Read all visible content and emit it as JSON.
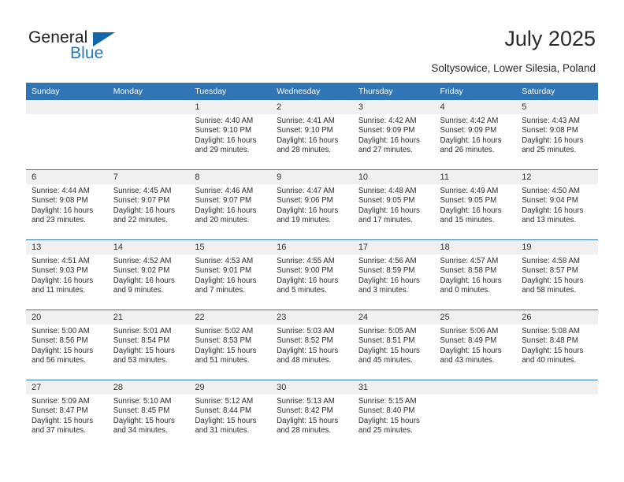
{
  "brand": {
    "name_part1": "General",
    "name_part2": "Blue",
    "triangle_color": "#1266ab",
    "blue_color": "#1f7ac4"
  },
  "header": {
    "title": "July 2025",
    "subtitle": "Soltysowice, Lower Silesia, Poland",
    "accent_color": "#3075b5"
  },
  "calendar": {
    "weekdays": [
      "Sunday",
      "Monday",
      "Tuesday",
      "Wednesday",
      "Thursday",
      "Friday",
      "Saturday"
    ],
    "labels": {
      "sunrise": "Sunrise:",
      "sunset": "Sunset:",
      "daylight": "Daylight:"
    },
    "weeks": [
      [
        {
          "day": "",
          "empty": true
        },
        {
          "day": "",
          "empty": true
        },
        {
          "day": "1",
          "sunrise": "Sunrise: 4:40 AM",
          "sunset": "Sunset: 9:10 PM",
          "daylight_l1": "Daylight: 16 hours",
          "daylight_l2": "and 29 minutes."
        },
        {
          "day": "2",
          "sunrise": "Sunrise: 4:41 AM",
          "sunset": "Sunset: 9:10 PM",
          "daylight_l1": "Daylight: 16 hours",
          "daylight_l2": "and 28 minutes."
        },
        {
          "day": "3",
          "sunrise": "Sunrise: 4:42 AM",
          "sunset": "Sunset: 9:09 PM",
          "daylight_l1": "Daylight: 16 hours",
          "daylight_l2": "and 27 minutes."
        },
        {
          "day": "4",
          "sunrise": "Sunrise: 4:42 AM",
          "sunset": "Sunset: 9:09 PM",
          "daylight_l1": "Daylight: 16 hours",
          "daylight_l2": "and 26 minutes."
        },
        {
          "day": "5",
          "sunrise": "Sunrise: 4:43 AM",
          "sunset": "Sunset: 9:08 PM",
          "daylight_l1": "Daylight: 16 hours",
          "daylight_l2": "and 25 minutes."
        }
      ],
      [
        {
          "day": "6",
          "sunrise": "Sunrise: 4:44 AM",
          "sunset": "Sunset: 9:08 PM",
          "daylight_l1": "Daylight: 16 hours",
          "daylight_l2": "and 23 minutes."
        },
        {
          "day": "7",
          "sunrise": "Sunrise: 4:45 AM",
          "sunset": "Sunset: 9:07 PM",
          "daylight_l1": "Daylight: 16 hours",
          "daylight_l2": "and 22 minutes."
        },
        {
          "day": "8",
          "sunrise": "Sunrise: 4:46 AM",
          "sunset": "Sunset: 9:07 PM",
          "daylight_l1": "Daylight: 16 hours",
          "daylight_l2": "and 20 minutes."
        },
        {
          "day": "9",
          "sunrise": "Sunrise: 4:47 AM",
          "sunset": "Sunset: 9:06 PM",
          "daylight_l1": "Daylight: 16 hours",
          "daylight_l2": "and 19 minutes."
        },
        {
          "day": "10",
          "sunrise": "Sunrise: 4:48 AM",
          "sunset": "Sunset: 9:05 PM",
          "daylight_l1": "Daylight: 16 hours",
          "daylight_l2": "and 17 minutes."
        },
        {
          "day": "11",
          "sunrise": "Sunrise: 4:49 AM",
          "sunset": "Sunset: 9:05 PM",
          "daylight_l1": "Daylight: 16 hours",
          "daylight_l2": "and 15 minutes."
        },
        {
          "day": "12",
          "sunrise": "Sunrise: 4:50 AM",
          "sunset": "Sunset: 9:04 PM",
          "daylight_l1": "Daylight: 16 hours",
          "daylight_l2": "and 13 minutes."
        }
      ],
      [
        {
          "day": "13",
          "sunrise": "Sunrise: 4:51 AM",
          "sunset": "Sunset: 9:03 PM",
          "daylight_l1": "Daylight: 16 hours",
          "daylight_l2": "and 11 minutes."
        },
        {
          "day": "14",
          "sunrise": "Sunrise: 4:52 AM",
          "sunset": "Sunset: 9:02 PM",
          "daylight_l1": "Daylight: 16 hours",
          "daylight_l2": "and 9 minutes."
        },
        {
          "day": "15",
          "sunrise": "Sunrise: 4:53 AM",
          "sunset": "Sunset: 9:01 PM",
          "daylight_l1": "Daylight: 16 hours",
          "daylight_l2": "and 7 minutes."
        },
        {
          "day": "16",
          "sunrise": "Sunrise: 4:55 AM",
          "sunset": "Sunset: 9:00 PM",
          "daylight_l1": "Daylight: 16 hours",
          "daylight_l2": "and 5 minutes."
        },
        {
          "day": "17",
          "sunrise": "Sunrise: 4:56 AM",
          "sunset": "Sunset: 8:59 PM",
          "daylight_l1": "Daylight: 16 hours",
          "daylight_l2": "and 3 minutes."
        },
        {
          "day": "18",
          "sunrise": "Sunrise: 4:57 AM",
          "sunset": "Sunset: 8:58 PM",
          "daylight_l1": "Daylight: 16 hours",
          "daylight_l2": "and 0 minutes."
        },
        {
          "day": "19",
          "sunrise": "Sunrise: 4:58 AM",
          "sunset": "Sunset: 8:57 PM",
          "daylight_l1": "Daylight: 15 hours",
          "daylight_l2": "and 58 minutes."
        }
      ],
      [
        {
          "day": "20",
          "sunrise": "Sunrise: 5:00 AM",
          "sunset": "Sunset: 8:56 PM",
          "daylight_l1": "Daylight: 15 hours",
          "daylight_l2": "and 56 minutes."
        },
        {
          "day": "21",
          "sunrise": "Sunrise: 5:01 AM",
          "sunset": "Sunset: 8:54 PM",
          "daylight_l1": "Daylight: 15 hours",
          "daylight_l2": "and 53 minutes."
        },
        {
          "day": "22",
          "sunrise": "Sunrise: 5:02 AM",
          "sunset": "Sunset: 8:53 PM",
          "daylight_l1": "Daylight: 15 hours",
          "daylight_l2": "and 51 minutes."
        },
        {
          "day": "23",
          "sunrise": "Sunrise: 5:03 AM",
          "sunset": "Sunset: 8:52 PM",
          "daylight_l1": "Daylight: 15 hours",
          "daylight_l2": "and 48 minutes."
        },
        {
          "day": "24",
          "sunrise": "Sunrise: 5:05 AM",
          "sunset": "Sunset: 8:51 PM",
          "daylight_l1": "Daylight: 15 hours",
          "daylight_l2": "and 45 minutes."
        },
        {
          "day": "25",
          "sunrise": "Sunrise: 5:06 AM",
          "sunset": "Sunset: 8:49 PM",
          "daylight_l1": "Daylight: 15 hours",
          "daylight_l2": "and 43 minutes."
        },
        {
          "day": "26",
          "sunrise": "Sunrise: 5:08 AM",
          "sunset": "Sunset: 8:48 PM",
          "daylight_l1": "Daylight: 15 hours",
          "daylight_l2": "and 40 minutes."
        }
      ],
      [
        {
          "day": "27",
          "sunrise": "Sunrise: 5:09 AM",
          "sunset": "Sunset: 8:47 PM",
          "daylight_l1": "Daylight: 15 hours",
          "daylight_l2": "and 37 minutes."
        },
        {
          "day": "28",
          "sunrise": "Sunrise: 5:10 AM",
          "sunset": "Sunset: 8:45 PM",
          "daylight_l1": "Daylight: 15 hours",
          "daylight_l2": "and 34 minutes."
        },
        {
          "day": "29",
          "sunrise": "Sunrise: 5:12 AM",
          "sunset": "Sunset: 8:44 PM",
          "daylight_l1": "Daylight: 15 hours",
          "daylight_l2": "and 31 minutes."
        },
        {
          "day": "30",
          "sunrise": "Sunrise: 5:13 AM",
          "sunset": "Sunset: 8:42 PM",
          "daylight_l1": "Daylight: 15 hours",
          "daylight_l2": "and 28 minutes."
        },
        {
          "day": "31",
          "sunrise": "Sunrise: 5:15 AM",
          "sunset": "Sunset: 8:40 PM",
          "daylight_l1": "Daylight: 15 hours",
          "daylight_l2": "and 25 minutes."
        },
        {
          "day": "",
          "empty": true
        },
        {
          "day": "",
          "empty": true
        }
      ]
    ]
  }
}
